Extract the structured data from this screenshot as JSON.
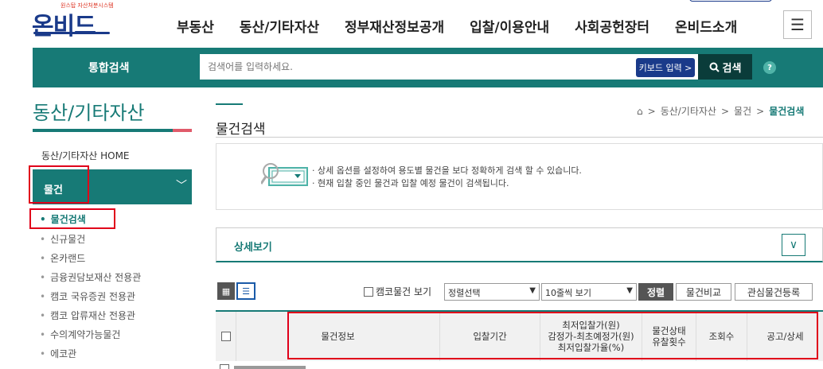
{
  "header": {
    "logo_tagline": "원스탑 자산처분시스템",
    "logo_text": "온비드",
    "nav": [
      "부동산",
      "동산/기타자산",
      "정부재산정보공개",
      "입찰/이용안내",
      "사회공헌장터",
      "온비드소개"
    ],
    "menu_icon": "hamburger-icon"
  },
  "search": {
    "label": "통합검색",
    "placeholder": "검색어를 입력하세요.",
    "keyboard_label": "키보드 입력 >",
    "button_label": "검색",
    "help": "?"
  },
  "sidebar": {
    "title": "동산/기타자산",
    "home": "동산/기타자산 HOME",
    "active_section": "물건",
    "items": [
      {
        "label": "물건검색",
        "active": true
      },
      {
        "label": "신규물건",
        "active": false
      },
      {
        "label": "온카랜드",
        "active": false
      },
      {
        "label": "금융권담보재산 전용관",
        "active": false
      },
      {
        "label": "캠코 국유증권 전용관",
        "active": false
      },
      {
        "label": "캠코 압류재산 전용관",
        "active": false
      },
      {
        "label": "수의계약가능물건",
        "active": false
      },
      {
        "label": "에코관",
        "active": false
      }
    ]
  },
  "main": {
    "title": "물건검색",
    "breadcrumb": [
      "동산/기타자산",
      "물건",
      "물건검색"
    ],
    "info_lines": [
      "· 상세 옵션를 설정하여 용도별 물건을 보다 정확하게 검색 할 수 있습니다.",
      "· 현재 입찰 중인 물건과 입찰 예정 물건이 검색됩니다."
    ],
    "detail_label": "상세보기",
    "toolbar": {
      "camco_label": "캠코물건 보기",
      "sort_select": "정렬선택",
      "page_size_select": "10줄씩 보기",
      "sort_button": "정렬",
      "compare_button": "물건비교",
      "interest_button": "관심물건등록"
    },
    "table_headers": {
      "info": "물건정보",
      "period": "입찰기간",
      "price_line1": "최저입찰가(원)",
      "price_line2": "감정가-최초예정가(원)",
      "price_line3": "최저입찰가율(%)",
      "status_line1": "물건상태",
      "status_line2": "유찰횟수",
      "views": "조회수",
      "notice": "공고/상세"
    }
  },
  "colors": {
    "brand_teal": "#177a76",
    "brand_navy": "#1a3a8a",
    "highlight_red": "#e0001a"
  }
}
